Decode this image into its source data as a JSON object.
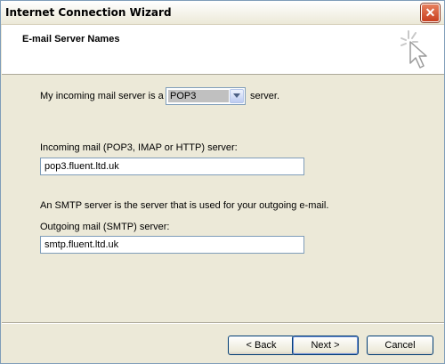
{
  "window": {
    "title": "Internet Connection Wizard",
    "close_glyph": "✕"
  },
  "header": {
    "title": "E-mail Server Names",
    "icon": "pointer-click-icon"
  },
  "form": {
    "incoming_type_label": "My incoming mail server is a",
    "incoming_type_value": "POP3",
    "incoming_type_suffix": "server.",
    "incoming_server_label": "Incoming mail (POP3, IMAP or HTTP) server:",
    "incoming_server_value": "pop3.fluent.ltd.uk",
    "smtp_note": "An SMTP server is the server that is used for your outgoing e-mail.",
    "outgoing_server_label": "Outgoing mail (SMTP) server:",
    "outgoing_server_value": "smtp.fluent.ltd.uk"
  },
  "buttons": {
    "back": "< Back",
    "next": "Next >",
    "cancel": "Cancel"
  },
  "colors": {
    "close_button": "#c9401f",
    "window_bg": "#ece9d8",
    "focus_border": "#7f9db9"
  }
}
